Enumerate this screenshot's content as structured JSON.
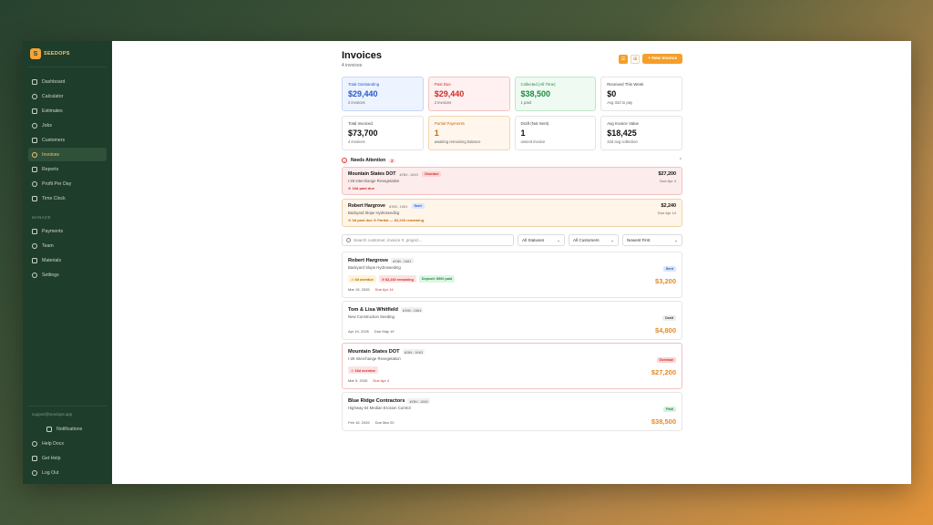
{
  "brand": {
    "name": "SEEDOPS",
    "mark": "S"
  },
  "sidebar": {
    "items": [
      {
        "label": "Dashboard",
        "icon": "grid-icon"
      },
      {
        "label": "Calculator",
        "icon": "calculator-icon"
      },
      {
        "label": "Estimates",
        "icon": "file-icon"
      },
      {
        "label": "Jobs",
        "icon": "briefcase-icon"
      },
      {
        "label": "Customers",
        "icon": "users-icon"
      },
      {
        "label": "Invoices",
        "icon": "receipt-icon",
        "active": true
      },
      {
        "label": "Reports",
        "icon": "bar-chart-icon"
      },
      {
        "label": "Profit Per Day",
        "icon": "trend-icon"
      },
      {
        "label": "Time Clock",
        "icon": "clock-icon"
      }
    ],
    "section_label": "MANAGE",
    "manage_items": [
      {
        "label": "Payments",
        "icon": "card-icon"
      },
      {
        "label": "Team",
        "icon": "team-icon"
      },
      {
        "label": "Materials",
        "icon": "leaf-icon"
      },
      {
        "label": "Settings",
        "icon": "gear-icon"
      }
    ],
    "support_email": "support@seedops.app",
    "bottom_items": [
      {
        "label": "Notifications",
        "icon": "bell-icon"
      },
      {
        "label": "Help Docs",
        "icon": "book-icon"
      },
      {
        "label": "Get Help",
        "icon": "chat-icon"
      },
      {
        "label": "Log Out",
        "icon": "logout-icon"
      }
    ]
  },
  "header": {
    "title": "Invoices",
    "subtitle": "4 invoices",
    "new_button": "+ New Invoice"
  },
  "stats": [
    {
      "label": "Total Outstanding",
      "value": "$29,440",
      "sub": "2 invoices",
      "tone": "blue"
    },
    {
      "label": "Past Due",
      "value": "$29,440",
      "sub": "2 invoices",
      "tone": "red"
    },
    {
      "label": "Collected (All Time)",
      "value": "$38,500",
      "sub": "1 paid",
      "tone": "green"
    },
    {
      "label": "Received This Week",
      "value": "$0",
      "sub": "Avg 32d to pay",
      "tone": ""
    },
    {
      "label": "Total Invoiced",
      "value": "$73,700",
      "sub": "4 invoices",
      "tone": ""
    },
    {
      "label": "Partial Payments",
      "value": "1",
      "sub": "awaiting remaining balance",
      "tone": "orange"
    },
    {
      "label": "Draft (Not Sent)",
      "value": "1",
      "sub": "unsent invoice",
      "tone": ""
    },
    {
      "label": "Avg Invoice Value",
      "value": "$18,425",
      "sub": "32d avg collection",
      "tone": ""
    }
  ],
  "attention": {
    "title": "Needs Attention",
    "count": "2",
    "items": [
      {
        "name": "Mountain States DOT",
        "number": "#INV-1003",
        "badge": "Overdue",
        "desc": "I-26 Interchange Revegetation",
        "warn": "⊙ 16d past due",
        "amount": "$27,200",
        "due": "Due Apr 4",
        "tone": "red"
      },
      {
        "name": "Robert Hargrove",
        "number": "#INV-1001",
        "badge": "Sent",
        "desc": "Backyard Slope Hydroseeding",
        "warn": "⊙ 0d past due   ⊙ Partial — $2,240 remaining",
        "amount": "$2,240",
        "due": "Due Apr 14",
        "tone": "orange"
      }
    ]
  },
  "filters": {
    "search_placeholder": "Search customer, invoice #, project...",
    "status": "All Statuses",
    "customers": "All Customers",
    "sort": "Newest First"
  },
  "invoices": [
    {
      "name": "Robert Hargrove",
      "number": "#INV-1001",
      "desc": "Backyard Slope Hydroseeding",
      "badge": "Sent",
      "badge_tone": "sent",
      "amount": "$3,200",
      "tags": [
        {
          "t": "⚠ 6d overdue",
          "c": "yellow"
        },
        {
          "t": "⊙ $2,240 remaining",
          "c": "red"
        },
        {
          "t": "Deposit: $960 paid",
          "c": "green"
        }
      ],
      "created": "Mar 15, 2026",
      "due": "Due Apr 14",
      "due_red": true
    },
    {
      "name": "Tom & Lisa Whitfield",
      "number": "#INV-1004",
      "desc": "New Construction Seeding",
      "badge": "Draft",
      "badge_tone": "draft",
      "amount": "$4,800",
      "tags": [],
      "created": "Apr 19, 2026",
      "due": "Due May 19",
      "due_red": false
    },
    {
      "name": "Mountain States DOT",
      "number": "#INV-1003",
      "desc": "I-26 Interchange Revegetation",
      "badge": "Overdue",
      "badge_tone": "overdue",
      "amount": "$27,200",
      "tags": [
        {
          "t": "⚠ 16d overdue",
          "c": "red"
        }
      ],
      "created": "Mar 5, 2026",
      "due": "Due Apr 4",
      "due_red": true
    },
    {
      "name": "Blue Ridge Contractors",
      "number": "#INV-1002",
      "desc": "Highway 64 Median Erosion Control",
      "badge": "Paid",
      "badge_tone": "paid",
      "amount": "$38,500",
      "tags": [],
      "created": "Feb 18, 2026",
      "due": "Due Mar 20",
      "due_red": false
    }
  ]
}
